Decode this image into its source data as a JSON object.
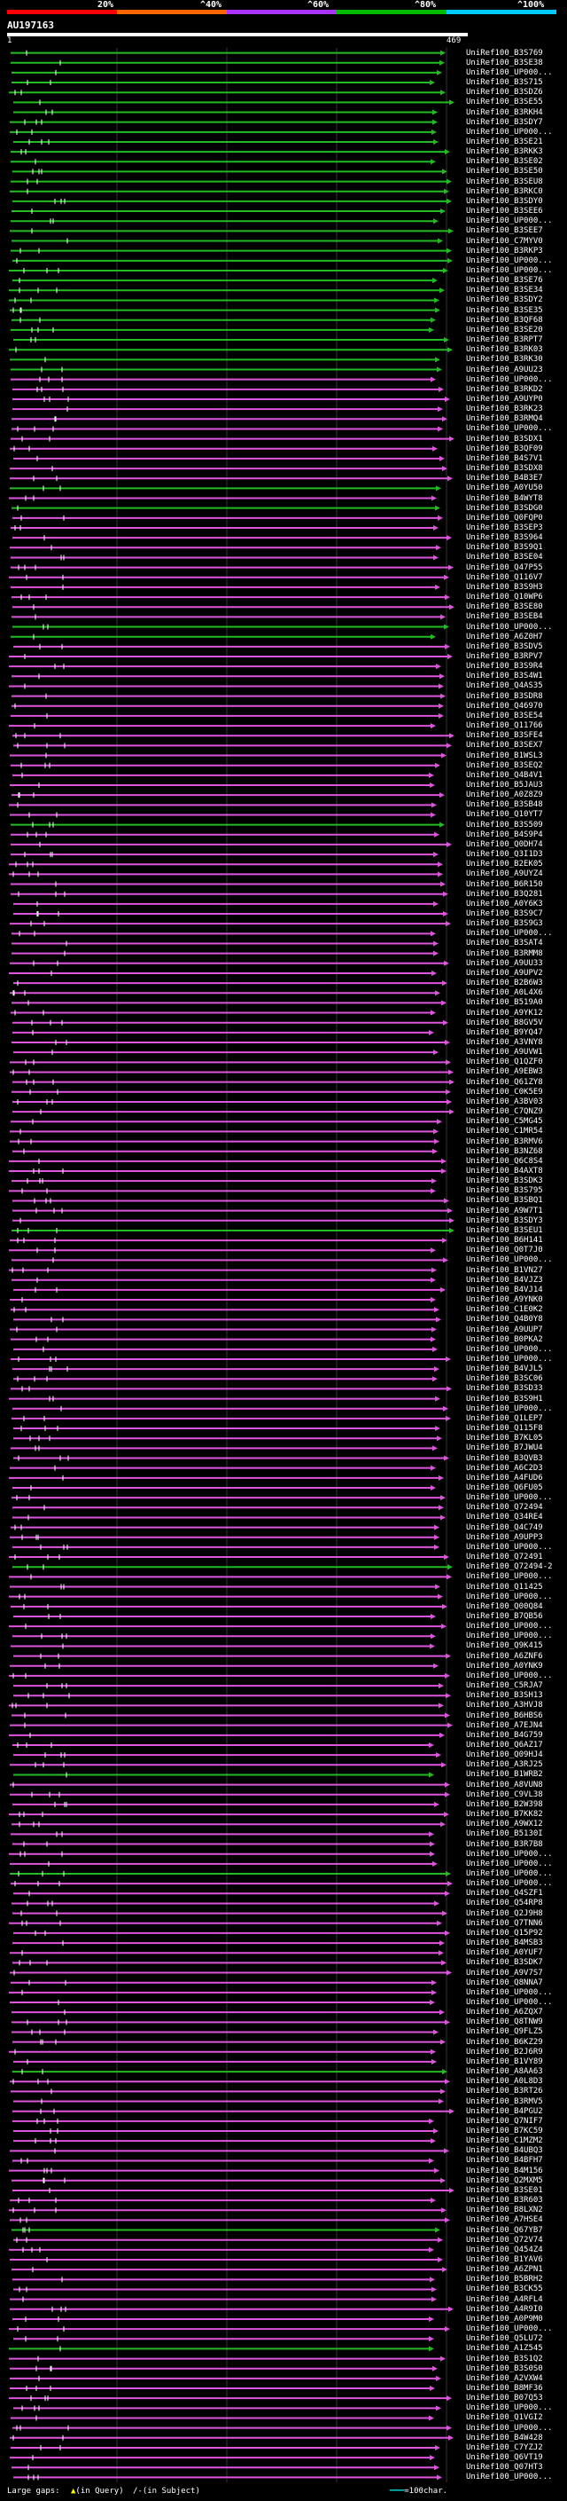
{
  "header": {
    "scale_labels": [
      "20%",
      "^40%",
      "^60%",
      "^80%",
      "^100%"
    ],
    "scale_colors": [
      "#ff0000",
      "#ff6600",
      "#aa33ff",
      "#00bb00",
      "#00ccff"
    ]
  },
  "query": {
    "name": "AU197163",
    "start_label": "1",
    "end_label": "469"
  },
  "hits": [
    "UniRef100_B3S769",
    "UniRef100_B3SE38",
    "UniRef100_UP000...",
    "UniRef100_B3S715",
    "UniRef100_B3SDZ6",
    "UniRef100_B3SE55",
    "UniRef100_B3RKH4",
    "UniRef100_B3SDY7",
    "UniRef100_UP000...",
    "UniRef100_B3SE21",
    "UniRef100_B3RKK3",
    "UniRef100_B3SE02",
    "UniRef100_B3SE50",
    "UniRef100_B3SEU8",
    "UniRef100_B3RKC0",
    "UniRef100_B3SDY0",
    "UniRef100_B3SEE6",
    "UniRef100_UP000...",
    "UniRef100_B3SEE7",
    "UniRef100_C7MYV0",
    "UniRef100_B3RKP3",
    "UniRef100_UP000...",
    "UniRef100_UP000...",
    "UniRef100_B3SE76",
    "UniRef100_B3SE34",
    "UniRef100_B3SDY2",
    "UniRef100_B3SE35",
    "UniRef100_B3QF68",
    "UniRef100_B3SE20",
    "UniRef100_B3RPT7",
    "UniRef100_B3RK03",
    "UniRef100_B3RK30",
    "UniRef100_A9UU23",
    "UniRef100_UP000...",
    "UniRef100_B3RKD2",
    "UniRef100_A9UYP0",
    "UniRef100_B3RK23",
    "UniRef100_B3RMQ4",
    "UniRef100_UP000...",
    "UniRef100_B3SDX1",
    "UniRef100_B3QF09",
    "UniRef100_B4S7V1",
    "UniRef100_B3SDX8",
    "UniRef100_B4B3E7",
    "UniRef100_A0YU50",
    "UniRef100_B4WYT8",
    "UniRef100_B3SDG0",
    "UniRef100_Q0FQP0",
    "UniRef100_B3SEP3",
    "UniRef100_B3S964",
    "UniRef100_B3S9Q1",
    "UniRef100_B3SE04",
    "UniRef100_Q47P55",
    "UniRef100_Q116V7",
    "UniRef100_B3S9H3",
    "UniRef100_Q10WP6",
    "UniRef100_B3SE80",
    "UniRef100_B3SEB4",
    "UniRef100_UP000...",
    "UniRef100_A6Z0H7",
    "UniRef100_B3SDV5",
    "UniRef100_B3RPV7",
    "UniRef100_B3S9R4",
    "UniRef100_B3S4W1",
    "UniRef100_Q4AS35",
    "UniRef100_B3SDR8",
    "UniRef100_Q46970",
    "UniRef100_B3SE54",
    "UniRef100_Q11766",
    "UniRef100_B3SFE4",
    "UniRef100_B3SEX7",
    "UniRef100_B1WSL3",
    "UniRef100_B3SEQ2",
    "UniRef100_Q4B4V1",
    "UniRef100_B5JAU3",
    "UniRef100_A0Z8Z9",
    "UniRef100_B3SB48",
    "UniRef100_Q10YT7",
    "UniRef100_B3S509",
    "UniRef100_B4S9P4",
    "UniRef100_Q0DH74",
    "UniRef100_Q3I1D3",
    "UniRef100_B2EK05",
    "UniRef100_A9UYZ4",
    "UniRef100_B6R150",
    "UniRef100_B3Q281",
    "UniRef100_A0Y6K3",
    "UniRef100_B3S9C7",
    "UniRef100_B3S9G3",
    "UniRef100_UP000...",
    "UniRef100_B3SAT4",
    "UniRef100_B3RMM8",
    "UniRef100_A9UU33",
    "UniRef100_A9UPV2",
    "UniRef100_B2B6W3",
    "UniRef100_A0L4X6",
    "UniRef100_B519A0",
    "UniRef100_A9YK12",
    "UniRef100_B8GV5V",
    "UniRef100_B9YQ47",
    "UniRef100_A3VNY8",
    "UniRef100_A9UVW1",
    "UniRef100_Q1QZF0",
    "UniRef100_A9EBW3",
    "UniRef100_Q61ZY8",
    "UniRef100_C0K5E9",
    "UniRef100_A3BV03",
    "UniRef100_C7QNZ9",
    "UniRef100_C5MG45",
    "UniRef100_C1MR54",
    "UniRef100_B3RMV6",
    "UniRef100_B3NZ68",
    "UniRef100_Q6C8S4",
    "UniRef100_B4AXT8",
    "UniRef100_B3SDK3",
    "UniRef100_B3S795",
    "UniRef100_B3SBQ1",
    "UniRef100_A9W7T1",
    "UniRef100_B3SDY3",
    "UniRef100_B3SEU1",
    "UniRef100_B6H141",
    "UniRef100_Q0T7J0",
    "UniRef100_UP000...",
    "UniRef100_B1VN27",
    "UniRef100_B4VJZ3",
    "UniRef100_B4VJ14",
    "UniRef100_A9YNK0",
    "UniRef100_C1E0K2",
    "UniRef100_Q4B0Y8",
    "UniRef100_A9UUP7",
    "UniRef100_B0PKA2",
    "UniRef100_UP000...",
    "UniRef100_UP000...",
    "UniRef100_B4VJL5",
    "UniRef100_B3SC06",
    "UniRef100_B3SD33",
    "UniRef100_B3S9H1",
    "UniRef100_UP000...",
    "UniRef100_Q1LEP7",
    "UniRef100_Q115F8",
    "UniRef100_B7KL05",
    "UniRef100_B7JWU4",
    "UniRef100_B3QVB3",
    "UniRef100_A6C2D3",
    "UniRef100_A4FUD6",
    "UniRef100_Q6FU05",
    "UniRef100_UP000...",
    "UniRef100_Q72494",
    "UniRef100_Q34RE4",
    "UniRef100_Q4C749",
    "UniRef100_A9UPP3",
    "UniRef100_UP000...",
    "UniRef100_Q72491",
    "UniRef100_Q72494-2",
    "UniRef100_UP000...",
    "UniRef100_Q11425",
    "UniRef100_UP000...",
    "UniRef100_Q00Q84",
    "UniRef100_B7QB56",
    "UniRef100_UP000...",
    "UniRef100_UP000...",
    "UniRef100_Q9K415",
    "UniRef100_A6ZNF6",
    "UniRef100_A0YNK9",
    "UniRef100_UP000...",
    "UniRef100_C5RJA7",
    "UniRef100_B3SH13",
    "UniRef100_A3HVJ8",
    "UniRef100_B6HBS6",
    "UniRef100_A7EJN4",
    "UniRef100_B4G759",
    "UniRef100_Q6AZ17",
    "UniRef100_Q09HJ4",
    "UniRef100_A3RJ25",
    "UniRef100_B1WRB2",
    "UniRef100_A8VUN8",
    "UniRef100_C9VL38",
    "UniRef100_B2W398",
    "UniRef100_B7KK82",
    "UniRef100_A9WX12",
    "UniRef100_B5130I",
    "UniRef100_B3R7B8",
    "UniRef100_UP000...",
    "UniRef100_UP000...",
    "UniRef100_UP000...",
    "UniRef100_UP000...",
    "UniRef100_Q4SZF1",
    "UniRef100_Q54RP8",
    "UniRef100_Q2J9H8",
    "UniRef100_Q7TNN6",
    "UniRef100_Q15P92",
    "UniRef100_B4MSB3",
    "UniRef100_A0YUF7",
    "UniRef100_B3SDK7",
    "UniRef100_A9V7S7",
    "UniRef100_Q8NNA7",
    "UniRef100_UP000...",
    "UniRef100_UP000...",
    "UniRef100_A6ZQX7",
    "UniRef100_Q8TNW9",
    "UniRef100_Q9FLZ5",
    "UniRef100_B6KZ29",
    "UniRef100_B2J6R9",
    "UniRef100_B1VY89",
    "UniRef100_A8AA63",
    "UniRef100_A0L8D3",
    "UniRef100_B3RT26",
    "UniRef100_B3RMV5",
    "UniRef100_B4PGU2",
    "UniRef100_Q7NIF7",
    "UniRef100_B7KC59",
    "UniRef100_C1MZM2",
    "UniRef100_B4UBQ3",
    "UniRef100_B4BFH7",
    "UniRef100_B4M156",
    "UniRef100_Q2MXM5",
    "UniRef100_B3SE01",
    "UniRef100_B3R603",
    "UniRef100_B8LXN2",
    "UniRef100_A7HSE4",
    "UniRef100_Q67YB7",
    "UniRef100_Q72V74",
    "UniRef100_Q454Z4",
    "UniRef100_B1YAV6",
    "UniRef100_A6ZPN1",
    "UniRef100_B5BRH2",
    "UniRef100_B3CK55",
    "UniRef100_A4RFL4",
    "UniRef100_A4R9I0",
    "UniRef100_A0P9M0",
    "UniRef100_UP000...",
    "UniRef100_Q5LU72",
    "UniRef100_A1Z545",
    "UniRef100_B3S1Q2",
    "UniRef100_B3S0S0",
    "UniRef100_A2VXW4",
    "UniRef100_B8MF36",
    "UniRef100_B07Q53",
    "UniRef100_UP000...",
    "UniRef100_Q1VGI2",
    "UniRef100_UP000...",
    "UniRef100_B4W428",
    "UniRef100_C7YZJ2",
    "UniRef100_Q6VT19",
    "UniRef100_Q07HT3",
    "UniRef100_UP000..."
  ],
  "footer": {
    "gaps_label": "Large gaps:",
    "in_query": "(in Query)",
    "in_subject": "(in Subject)",
    "scale_label": "=100char."
  },
  "colors": {
    "green": "#22bb22",
    "magenta": "#dd55dd",
    "background": "#000000"
  }
}
